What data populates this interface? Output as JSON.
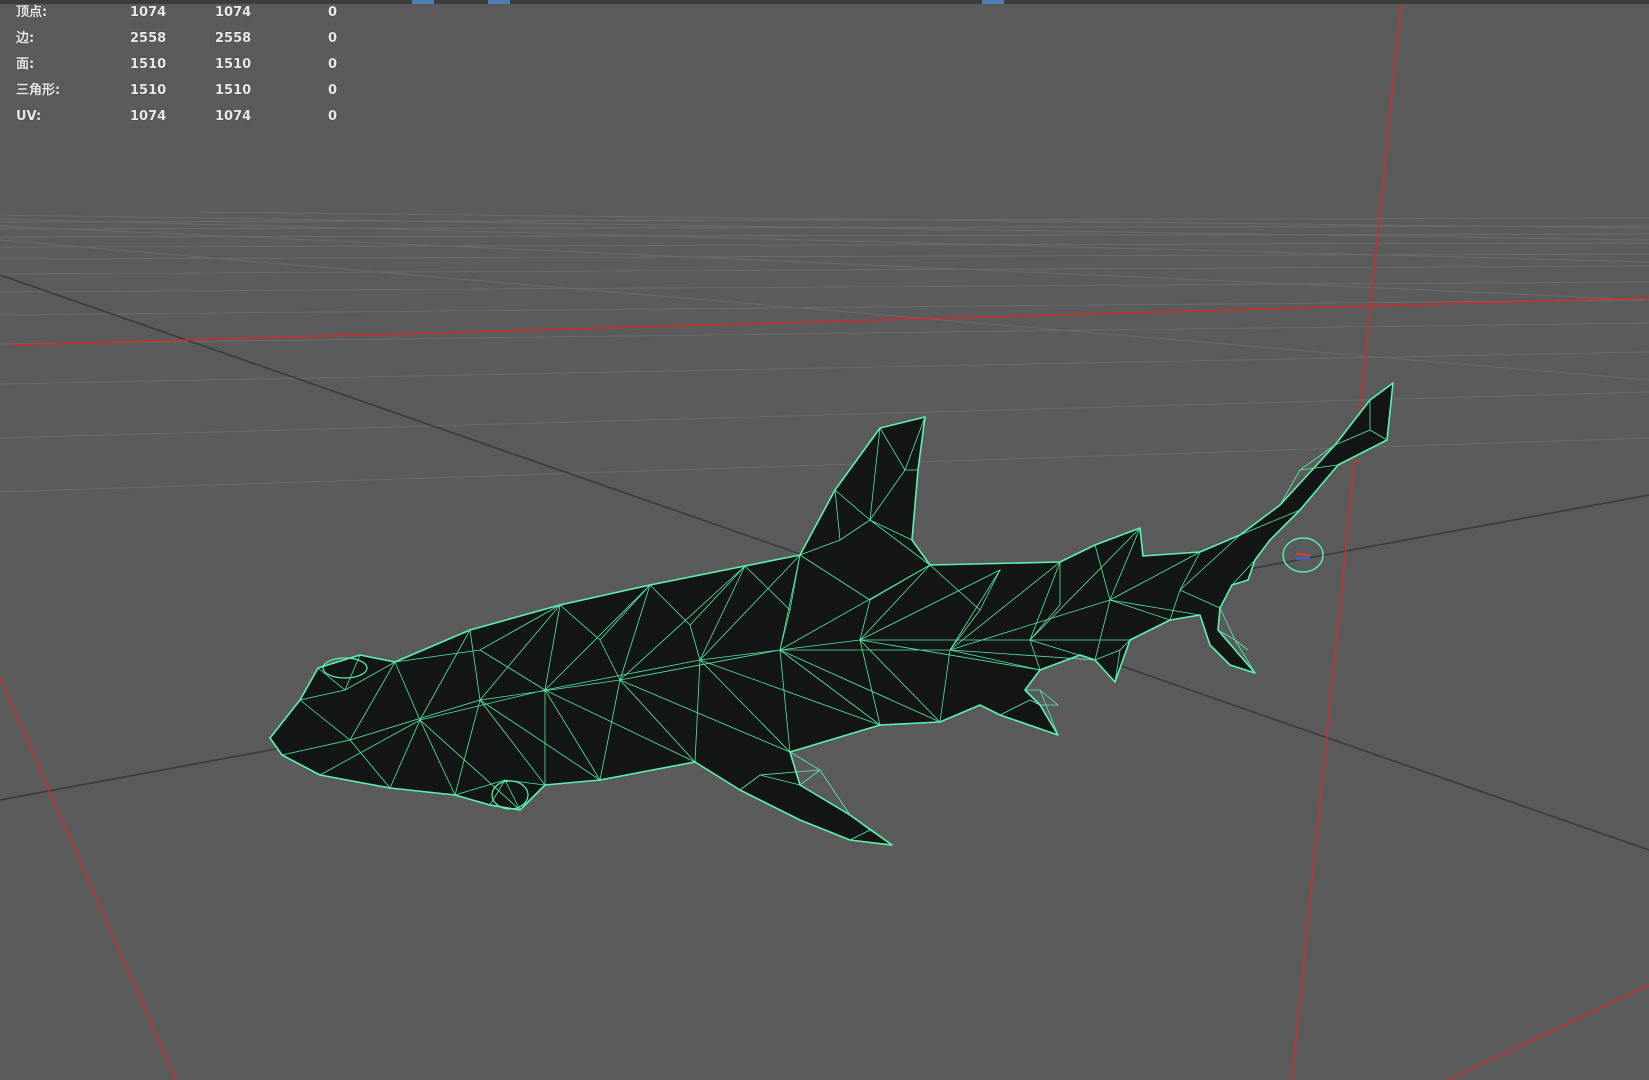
{
  "app": {
    "panel": "3D viewport"
  },
  "hud": {
    "rows": [
      {
        "label": "顶点:",
        "v1": "1074",
        "v2": "1074",
        "v3": "0"
      },
      {
        "label": "边:",
        "v1": "2558",
        "v2": "2558",
        "v3": "0"
      },
      {
        "label": "面:",
        "v1": "1510",
        "v2": "1510",
        "v3": "0"
      },
      {
        "label": "三角形:",
        "v1": "1510",
        "v2": "1510",
        "v3": "0"
      },
      {
        "label": "UV:",
        "v1": "1074",
        "v2": "1074",
        "v3": "0"
      }
    ]
  },
  "scene": {
    "object": "hammerhead-shark-mesh",
    "display_mode": "wireframe-on-shaded",
    "colors": {
      "background": "#5b5b5b",
      "grid": "#6a6a6a",
      "grid_axis": "#3a3a3a",
      "axis_red": "#d42a2a",
      "wireframe": "#5cf2b0",
      "mesh_fill": "#151716"
    }
  }
}
